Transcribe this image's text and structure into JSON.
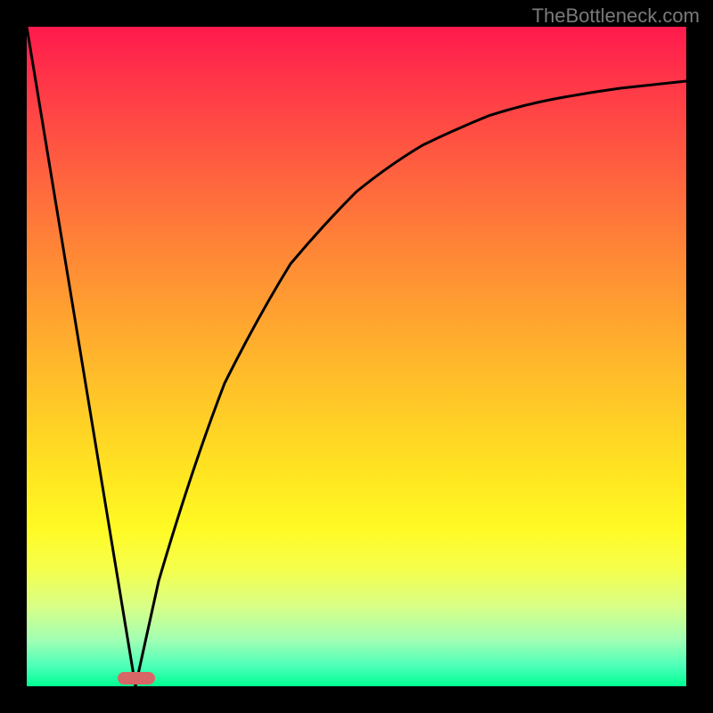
{
  "attribution": "TheBottleneck.com",
  "chart_data": {
    "type": "line",
    "title": "",
    "xlabel": "",
    "ylabel": "",
    "xlim": [
      0,
      100
    ],
    "ylim": [
      0,
      100
    ],
    "series": [
      {
        "name": "left-line",
        "x": [
          0,
          16.5
        ],
        "y": [
          100,
          0
        ]
      },
      {
        "name": "right-curve",
        "x": [
          16.5,
          20,
          25,
          30,
          35,
          40,
          45,
          50,
          55,
          60,
          65,
          70,
          75,
          80,
          85,
          90,
          95,
          100
        ],
        "y": [
          0,
          16,
          33,
          46,
          56,
          64,
          70,
          75,
          79,
          82,
          84.5,
          86.5,
          88,
          89,
          90,
          90.7,
          91.3,
          91.8
        ]
      }
    ],
    "marker": {
      "x_center": 16.5,
      "y": 0,
      "width_pct": 5.6,
      "color": "#d86666"
    },
    "gradient_colors": {
      "top": "#ff1a4d",
      "mid": "#ffe821",
      "bottom": "#00ff92"
    }
  }
}
